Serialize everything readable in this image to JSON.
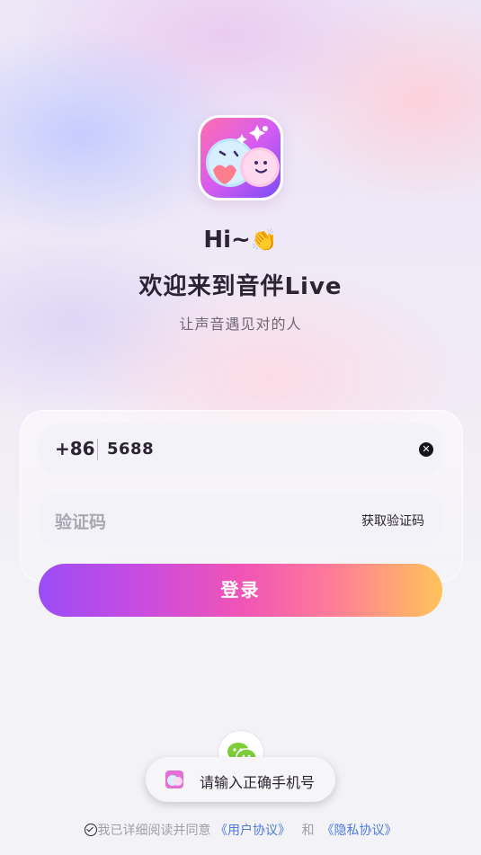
{
  "header": {
    "greeting": "Hi~",
    "greeting_emoji": "👏",
    "welcome": "欢迎来到音伴Live",
    "slogan": "让声音遇见对的人"
  },
  "login_form": {
    "country_code": "+86",
    "phone_value": "5688",
    "clear_icon": "clear-icon",
    "code_placeholder": "验证码",
    "get_code_label": "获取验证码",
    "login_label": "登录"
  },
  "social": {
    "wechat_icon": "wechat-icon"
  },
  "toast": {
    "message": "请输入正确手机号"
  },
  "agreement": {
    "prefix": "我已详细阅读并同意",
    "user_agreement": "《用户协议》",
    "and": "和",
    "privacy_agreement": "《隐私协议》"
  },
  "colors": {
    "accent_start": "#9b4cf6",
    "accent_mid": "#f054b6",
    "accent_end": "#ffc35a",
    "link": "#4d7bd8",
    "text_dark": "#2c2433"
  }
}
